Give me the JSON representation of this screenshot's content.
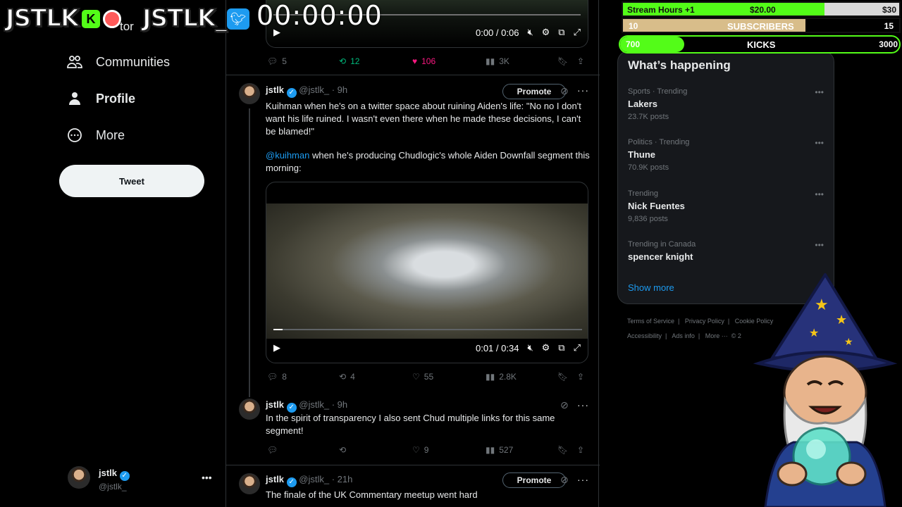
{
  "overlay": {
    "logo_left": "JSTLK",
    "logo_right": "JSTLK_",
    "timer": "00:00:00",
    "kick_icon_letter": "K",
    "creator_fragment": "tor",
    "goals": [
      {
        "label": "Stream Hours +1",
        "value": "$20.00",
        "target": "$30",
        "progress": 0.73,
        "color": "#53fc18"
      },
      {
        "label": "SUBSCRIBERS",
        "value": "10",
        "target": "15",
        "progress": 0.66,
        "color": "#d8bd8a"
      },
      {
        "label": "KICKS",
        "value": "700",
        "target": "3000",
        "progress": 0.23,
        "color": "#53fc18"
      }
    ]
  },
  "sidebar": {
    "items": [
      {
        "label": "Communities",
        "icon": "communities-icon"
      },
      {
        "label": "Profile",
        "icon": "profile-icon"
      },
      {
        "label": "More",
        "icon": "more-circle-icon"
      }
    ],
    "tweet_label": "Tweet",
    "account": {
      "name": "jstlk",
      "handle": "@jstlk_"
    }
  },
  "feed": {
    "top_video": {
      "time": "0:00 / 0:06"
    },
    "top_actions": {
      "replies": "5",
      "retweets": "12",
      "likes": "106",
      "views": "3K"
    },
    "tweets": [
      {
        "name": "jstlk",
        "handle": "@jstlk_",
        "age": "· 9h",
        "promote": "Promote",
        "text": "Kuihman when he's on a twitter space about ruining Aiden's life: \"No no I don't want his life ruined. I wasn't even there when he made these decisions, I can't be blamed!\"",
        "mention": "@kuihman",
        "text2": " when he's producing Chudlogic's whole Aiden Downfall segment this morning:",
        "video_time": "0:01 / 0:34",
        "video_progress": 0.03,
        "actions": {
          "replies": "8",
          "retweets": "4",
          "likes": "55",
          "views": "2.8K"
        }
      },
      {
        "name": "jstlk",
        "handle": "@jstlk_",
        "age": "· 9h",
        "text": "In the spirit of transparency I also sent Chud multiple links for this same segment!",
        "actions": {
          "replies": "",
          "retweets": "",
          "likes": "9",
          "views": "527"
        }
      },
      {
        "name": "jstlk",
        "handle": "@jstlk_",
        "age": "· 21h",
        "promote": "Promote",
        "text": "The finale of the UK Commentary meetup went hard"
      }
    ]
  },
  "trends": {
    "title": "What’s happening",
    "items": [
      {
        "meta": "Sports · Trending",
        "name": "Lakers",
        "count": "23.7K posts"
      },
      {
        "meta": "Politics · Trending",
        "name": "Thune",
        "count": "70.9K posts"
      },
      {
        "meta": "Trending",
        "name": "Nick Fuentes",
        "count": "9,836 posts"
      },
      {
        "meta": "Trending in Canada",
        "name": "spencer knight",
        "count": ""
      }
    ],
    "show_more": "Show more"
  },
  "footer": {
    "row1": [
      "Terms of Service",
      "Privacy Policy",
      "Cookie Policy"
    ],
    "row2": [
      "Accessibility",
      "Ads info",
      "More ···",
      "© 2"
    ]
  },
  "colors": {
    "accent": "#1d9bf0",
    "like": "#f91880",
    "retweet": "#00ba7c",
    "kick_green": "#53fc18"
  }
}
